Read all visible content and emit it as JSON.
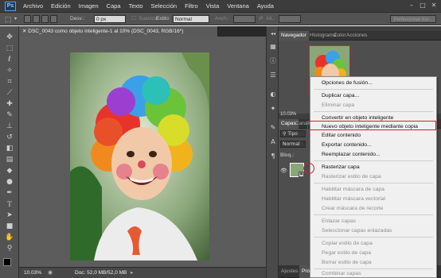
{
  "menubar": {
    "logo": "Ps",
    "items": [
      "Archivo",
      "Edición",
      "Imagen",
      "Capa",
      "Texto",
      "Selección",
      "Filtro",
      "Vista",
      "Ventana",
      "Ayuda"
    ]
  },
  "options": {
    "desv_label": "Desv.:",
    "desv_value": "0 px",
    "suavizar": "Suavizar",
    "estilo_label": "Estilo:",
    "estilo_value": "Normal",
    "anch_label": "Anch.:",
    "alt_label": "Alt.:",
    "perfeccionar": "Perfeccionar bor..."
  },
  "document": {
    "tab_title": "DSC_0043 como objeto inteligente-1 al 10% (DSC_0043, RGB/16*)",
    "zoom": "10.03%",
    "doc_size": "Doc: 52,0 MB/52,0 MB"
  },
  "panels": {
    "top_tabs": [
      "Navegador",
      "Histograma",
      "Color",
      "Acciones"
    ],
    "zoom_small": "10.03%",
    "layer_tabs": [
      "Capas",
      "Canales"
    ],
    "tipo": "Tipo",
    "blend": "Normal",
    "bloq": "Bloq.:",
    "bottom_tabs": [
      "Ajustes",
      "Pro"
    ]
  },
  "context_menu": {
    "items": [
      {
        "label": "Opciones de fusión...",
        "disabled": false
      },
      {
        "label": "Duplicar capa...",
        "disabled": false
      },
      {
        "label": "Eliminar capa",
        "disabled": true
      },
      {
        "label": "Convertir en objeto inteligente",
        "disabled": false
      },
      {
        "label": "Nuevo objeto inteligente mediante copia",
        "disabled": false,
        "highlighted": true
      },
      {
        "label": "Editar contenido",
        "disabled": false
      },
      {
        "label": "Exportar contenido...",
        "disabled": false
      },
      {
        "label": "Reemplazar contenido...",
        "disabled": false
      },
      {
        "label": "Rasterizar capa",
        "disabled": false
      },
      {
        "label": "Rasterizar estilo de capa",
        "disabled": true
      },
      {
        "label": "Habilitar máscara de capa",
        "disabled": true
      },
      {
        "label": "Habilitar máscara vectorial",
        "disabled": true
      },
      {
        "label": "Crear máscara de recorte",
        "disabled": true
      },
      {
        "label": "Enlazar capas",
        "disabled": true
      },
      {
        "label": "Seleccionar capas enlazadas",
        "disabled": true
      },
      {
        "label": "Copiar estilo de capa",
        "disabled": true
      },
      {
        "label": "Pegar estilo de capa",
        "disabled": true
      },
      {
        "label": "Borrar estilo de capa",
        "disabled": true
      },
      {
        "label": "Combinar capas",
        "disabled": true
      }
    ]
  },
  "colors": {
    "highlight": "#d0202a",
    "ui_dark": "#3c3c3c",
    "menu_bg": "#f0f0f0"
  }
}
